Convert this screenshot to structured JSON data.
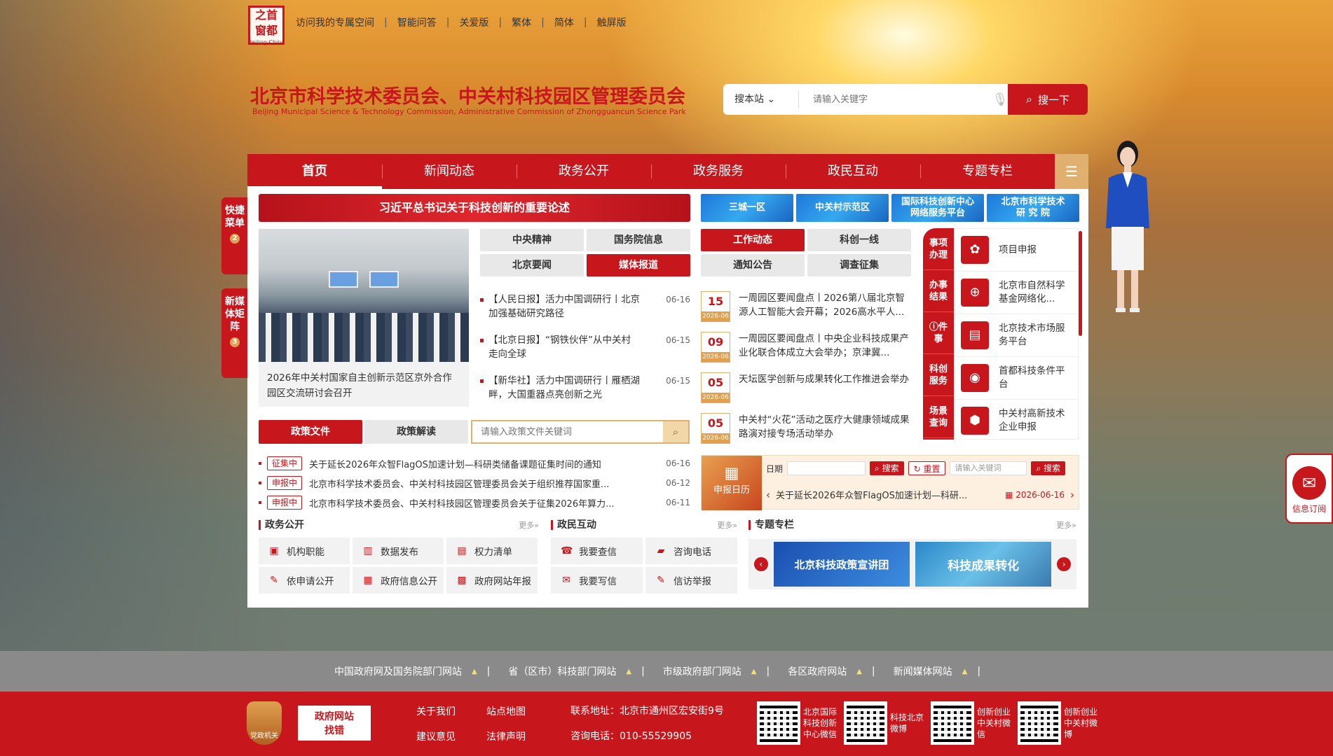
{
  "logo": {
    "text": "之首\n窗都",
    "sub": "Beijing·China"
  },
  "toplinks": [
    "访问我的专属空间",
    "智能问答",
    "关爱版",
    "繁体",
    "简体",
    "触屏版"
  ],
  "site": {
    "title": "北京市科学技术委员会、中关村科技园区管理委员会",
    "subtitle": "Beijing Municipal Science & Technology Commission, Administrative Commission of Zhongguancun Science Park"
  },
  "search": {
    "scope": "搜本站",
    "placeholder": "请输入关键字",
    "button": "搜一下"
  },
  "nav": [
    "首页",
    "新闻动态",
    "政务公开",
    "政务服务",
    "政民互动",
    "专题专栏"
  ],
  "float_left": [
    {
      "label": "快捷菜单",
      "count": "2"
    },
    {
      "label": "新媒体矩阵",
      "count": "3"
    }
  ],
  "banner_red": "习近平总书记关于科技创新的重要论述",
  "quick_banners": [
    "三城一区",
    "中关村示范区",
    "国际科技创新中心\n网络服务平台",
    "北京市科学技术\n研 究 院"
  ],
  "photo_caption": "2026年中关村国家自主创新示范区京外合作园区交流研讨会召开",
  "news_tabs": [
    {
      "label": "中央精神",
      "active": false
    },
    {
      "label": "国务院信息",
      "active": false
    },
    {
      "label": "北京要闻",
      "active": false
    },
    {
      "label": "媒体报道",
      "active": true
    }
  ],
  "news": [
    {
      "title": "【人民日报】活力中国调研行丨北京加强基础研究路径",
      "date": "06-16"
    },
    {
      "title": "【北京日报】“钢铁伙伴”从中关村走向全球",
      "date": "06-15"
    },
    {
      "title": "【新华社】活力中国调研行丨雁栖湖畔，大国重器点亮创新之光",
      "date": "06-15"
    }
  ],
  "work_tabs": [
    {
      "label": "工作动态",
      "active": true
    },
    {
      "label": "科创一线",
      "active": false
    },
    {
      "label": "通知公告",
      "active": false
    },
    {
      "label": "调查征集",
      "active": false
    }
  ],
  "work": [
    {
      "day": "15",
      "ym": "2026-06",
      "title": "一周园区要闻盘点丨2026第八届北京智源人工智能大会开幕；2026高水平人..."
    },
    {
      "day": "09",
      "ym": "2026-06",
      "title": "一周园区要闻盘点丨中央企业科技成果产业化联合体成立大会举办；京津冀..."
    },
    {
      "day": "05",
      "ym": "2026-06",
      "title": "天坛医学创新与成果转化工作推进会举办"
    },
    {
      "day": "05",
      "ym": "2026-06",
      "title": "中关村“火花”活动之医疗大健康领域成果路演对接专场活动举办"
    }
  ],
  "side_tabs": [
    "事项办理",
    "办事结果",
    "ⓘ件事",
    "科创服务",
    "场景查询"
  ],
  "services": [
    {
      "icon": "✿",
      "label": "项目申报"
    },
    {
      "icon": "⊕",
      "label": "北京市自然科学基金网络化..."
    },
    {
      "icon": "▤",
      "label": "北京技术市场服务平台"
    },
    {
      "icon": "◉",
      "label": "首都科技条件平台"
    },
    {
      "icon": "⬢",
      "label": "中关村高新技术企业申报"
    }
  ],
  "policy": {
    "tabs": [
      {
        "label": "政策文件",
        "active": true
      },
      {
        "label": "政策解读",
        "active": false
      }
    ],
    "placeholder": "请输入政策文件关键词",
    "items": [
      {
        "tag": "征集中",
        "title": "关于延长2026年众智FlagOS加速计划—科研类储备课题征集时间的通知",
        "date": "06-16"
      },
      {
        "tag": "申报中",
        "title": "北京市科学技术委员会、中关村科技园区管理委员会关于组织推荐国家重...",
        "date": "06-12"
      },
      {
        "tag": "申报中",
        "title": "北京市科学技术委员会、中关村科技园区管理委员会关于征集2026年算力...",
        "date": "06-11"
      }
    ]
  },
  "calendar": {
    "label": "申报日历",
    "date_label": "日期",
    "search": "搜索",
    "reset": "重置",
    "kw_placeholder": "请输入关键词",
    "item": "关于延长2026年众智FlagOS加速计划—科研...",
    "item_date": "2026-06-16"
  },
  "gov_open": {
    "title": "政务公开",
    "more": "更多»",
    "items": [
      {
        "icon": "▣",
        "label": "机构职能"
      },
      {
        "icon": "▥",
        "label": "数据发布"
      },
      {
        "icon": "▤",
        "label": "权力清单"
      },
      {
        "icon": "✎",
        "label": "依申请公开"
      },
      {
        "icon": "▦",
        "label": "政府信息公开"
      },
      {
        "icon": "▩",
        "label": "政府网站年报"
      }
    ]
  },
  "interact": {
    "title": "政民互动",
    "more": "更多»",
    "items": [
      {
        "icon": "☎",
        "label": "我要查信"
      },
      {
        "icon": "▰",
        "label": "咨询电话"
      },
      {
        "icon": "✉",
        "label": "我要写信"
      },
      {
        "icon": "✎",
        "label": "信访举报"
      }
    ]
  },
  "topics": {
    "title": "专题专栏",
    "more": "更多»",
    "items": [
      "北京科技政策宣讲团",
      "科技成果转化"
    ]
  },
  "message": "信息订阅",
  "friend_links": [
    "中国政府网及国务院部门网站",
    "省（区市）科技部门网站",
    "市级政府部门网站",
    "各区政府网站",
    "新闻媒体网站"
  ],
  "footer": {
    "badge": "党政机关",
    "find_error": "政府网站\n找错",
    "links": [
      "关于我们",
      "站点地图",
      "建议意见",
      "法律声明"
    ],
    "address": "联系地址：北京市通州区宏安街9号",
    "phone": "咨询电话：010-55529905",
    "qrs": [
      "北京国际科技创新中心微信",
      "科技北京微博",
      "创新创业中关村微信",
      "创新创业中关村微博"
    ]
  },
  "colors": {
    "brand": "#c8161d",
    "accent": "#e0b070"
  }
}
